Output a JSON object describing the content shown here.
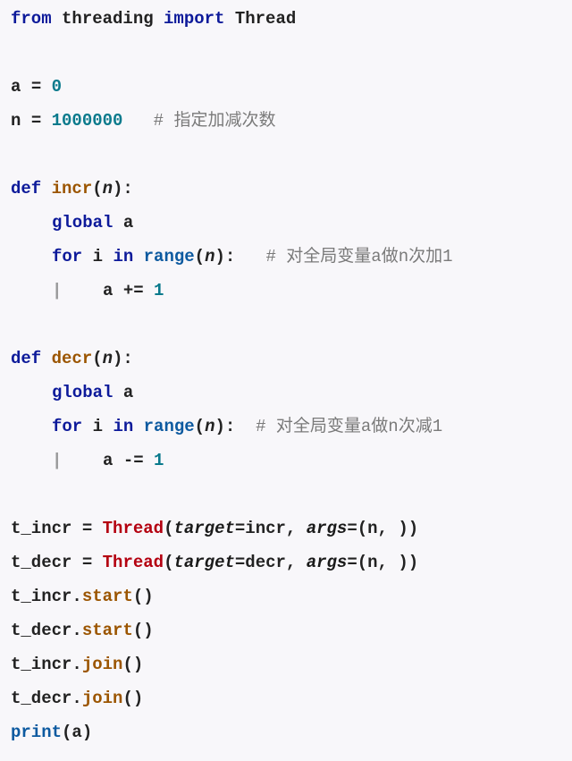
{
  "code": {
    "line1": {
      "kw_from": "from",
      "module": " threading ",
      "kw_import": "import",
      "name": " Thread"
    },
    "line3": {
      "var": "a ",
      "op": "=",
      "val": " 0"
    },
    "line4": {
      "var": "n ",
      "op": "=",
      "val": " 1000000",
      "comment": "   # 指定加减次数"
    },
    "line6": {
      "kw_def": "def ",
      "fname": "incr",
      "open": "(",
      "arg": "n",
      "close": "):"
    },
    "line7": {
      "kw": "global",
      "var": " a"
    },
    "line8": {
      "kw_for": "for",
      "var": " i ",
      "kw_in": "in",
      "sp": " ",
      "rng": "range",
      "open": "(",
      "arg": "n",
      "close": "):",
      "comment": "   # 对全局变量a做n次加1"
    },
    "line9": {
      "bar": "|    ",
      "var": "a ",
      "op": "+=",
      "val": " 1"
    },
    "line11": {
      "kw_def": "def ",
      "fname": "decr",
      "open": "(",
      "arg": "n",
      "close": "):"
    },
    "line12": {
      "kw": "global",
      "var": " a"
    },
    "line13": {
      "kw_for": "for",
      "var": " i ",
      "kw_in": "in",
      "sp": " ",
      "rng": "range",
      "open": "(",
      "arg": "n",
      "close": "):",
      "comment": "  # 对全局变量a做n次减1"
    },
    "line14": {
      "bar": "|    ",
      "var": "a ",
      "op": "-=",
      "val": " 1"
    },
    "line16": {
      "var": "t_incr ",
      "op": "= ",
      "cls": "Thread",
      "open": "(",
      "p1": "target",
      "eq1": "=incr, ",
      "p2": "args",
      "eq2": "=(n, ))"
    },
    "line17": {
      "var": "t_decr ",
      "op": "= ",
      "cls": "Thread",
      "open": "(",
      "p1": "target",
      "eq1": "=decr, ",
      "p2": "args",
      "eq2": "=(n, ))"
    },
    "line18": {
      "obj": "t_incr.",
      "meth": "start",
      "call": "()"
    },
    "line19": {
      "obj": "t_decr.",
      "meth": "start",
      "call": "()"
    },
    "line20": {
      "obj": "t_incr.",
      "meth": "join",
      "call": "()"
    },
    "line21": {
      "obj": "t_decr.",
      "meth": "join",
      "call": "()"
    },
    "line22": {
      "fn": "print",
      "open": "(",
      "arg": "a",
      "close": ")"
    }
  }
}
